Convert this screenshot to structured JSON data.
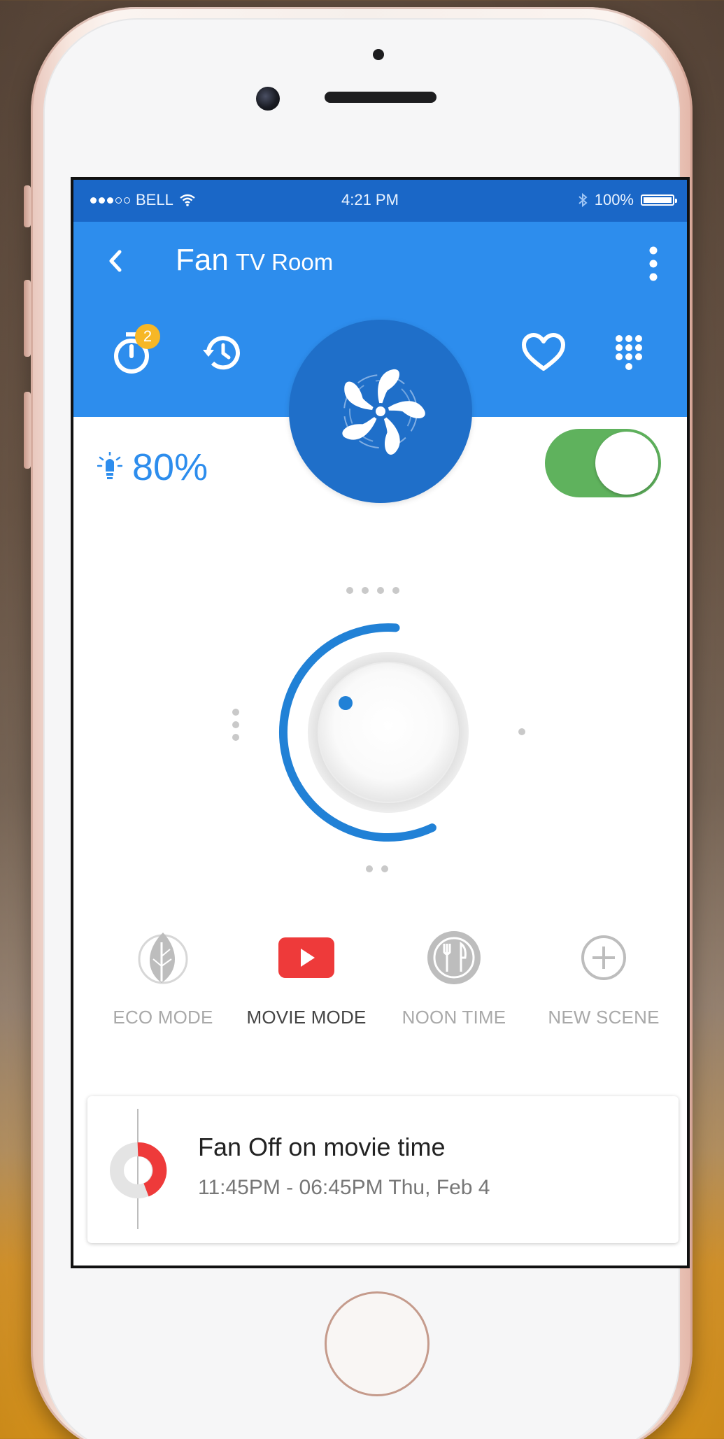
{
  "status_bar": {
    "carrier": "BELL",
    "time": "4:21 PM",
    "battery": "100%",
    "signal_bars_filled": 3,
    "signal_bars_total": 5
  },
  "header": {
    "title": "Fan",
    "subtitle": "TV Room"
  },
  "toolbar": {
    "timer_badge": "2"
  },
  "device": {
    "brightness": "80%",
    "power_on": true
  },
  "dial": {
    "level_fraction": 0.58
  },
  "scenes": [
    {
      "label": "ECO MODE",
      "icon": "leaf-icon",
      "active": false
    },
    {
      "label": "MOVIE MODE",
      "icon": "play-icon",
      "active": true
    },
    {
      "label": "NOON TIME",
      "icon": "dining-icon",
      "active": false
    },
    {
      "label": "NEW SCENE",
      "icon": "plus-icon",
      "active": false
    }
  ],
  "event": {
    "title": "Fan Off on movie time",
    "time": "11:45PM - 06:45PM Thu, Feb 4"
  },
  "colors": {
    "primary": "#2d8ded",
    "primary_dark": "#1a67c7",
    "fan_circle": "#1f6fc9",
    "toggle_on": "#5fb25d",
    "badge": "#f6b726",
    "movie_red": "#ee3a3a"
  }
}
